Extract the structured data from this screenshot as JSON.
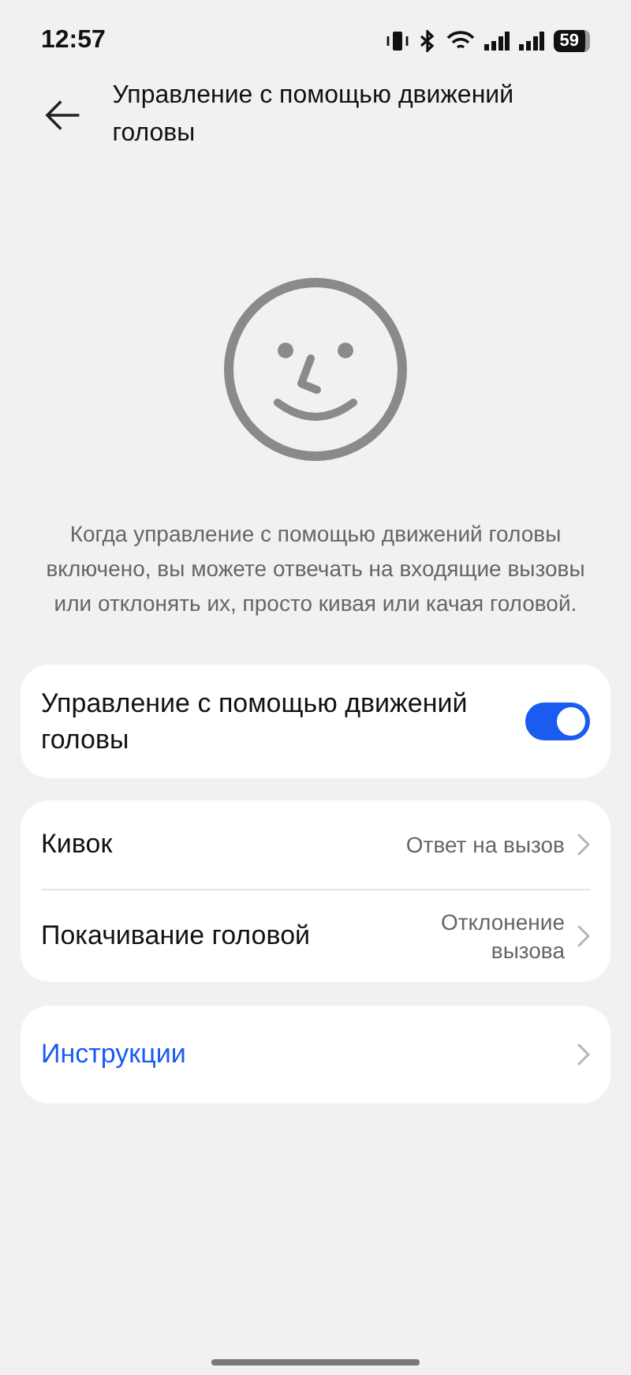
{
  "status_bar": {
    "time": "12:57",
    "battery": "59"
  },
  "header": {
    "title": "Управление с помощью движений головы"
  },
  "description": "Когда управление с помощью движений головы включено, вы можете отвечать на входящие вызовы или отклонять их, просто кивая или качая головой.",
  "toggle": {
    "label": "Управление с помощью движений головы",
    "on": true
  },
  "gestures": [
    {
      "label": "Кивок",
      "value": "Ответ на вызов"
    },
    {
      "label": "Покачивание головой",
      "value": "Отклонение вызова"
    }
  ],
  "instructions": {
    "label": "Инструкции"
  }
}
